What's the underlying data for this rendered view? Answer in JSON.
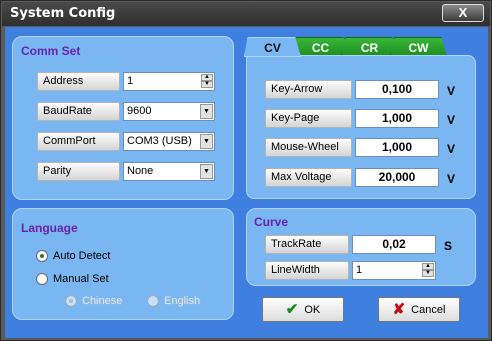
{
  "window": {
    "title": "System Config",
    "close_label": "X"
  },
  "comm_set": {
    "title": "Comm Set",
    "rows": [
      {
        "label": "Address",
        "value": "1"
      },
      {
        "label": "BaudRate",
        "value": "9600"
      },
      {
        "label": "CommPort",
        "value": "COM3 (USB)"
      },
      {
        "label": "Parity",
        "value": "None"
      }
    ]
  },
  "language": {
    "title": "Language",
    "options": [
      {
        "label": "Auto Detect",
        "selected": true
      },
      {
        "label": "Manual Set",
        "selected": false
      }
    ],
    "sub_options": [
      {
        "label": "Chinese",
        "selected": true,
        "enabled": false
      },
      {
        "label": "English",
        "selected": false,
        "enabled": false
      }
    ]
  },
  "tabs": [
    {
      "label": "CV",
      "active": true
    },
    {
      "label": "CC",
      "active": false
    },
    {
      "label": "CR",
      "active": false
    },
    {
      "label": "CW",
      "active": false
    }
  ],
  "cv_settings": [
    {
      "label": "Key-Arrow",
      "value": "0,100",
      "unit": "V"
    },
    {
      "label": "Key-Page",
      "value": "1,000",
      "unit": "V"
    },
    {
      "label": "Mouse-Wheel",
      "value": "1,000",
      "unit": "V"
    },
    {
      "label": "Max Voltage",
      "value": "20,000",
      "unit": "V"
    }
  ],
  "curve": {
    "title": "Curve",
    "track_rate": {
      "label": "TrackRate",
      "value": "0,02",
      "unit": "S"
    },
    "line_width": {
      "label": "LineWidth",
      "value": "1"
    }
  },
  "buttons": {
    "ok": "OK",
    "cancel": "Cancel"
  },
  "colors": {
    "client_bg": "#3f7fe0",
    "panel_bg": "#7ab7f2",
    "section_title": "#6a23a8",
    "tab_green": "#2aa52a"
  }
}
